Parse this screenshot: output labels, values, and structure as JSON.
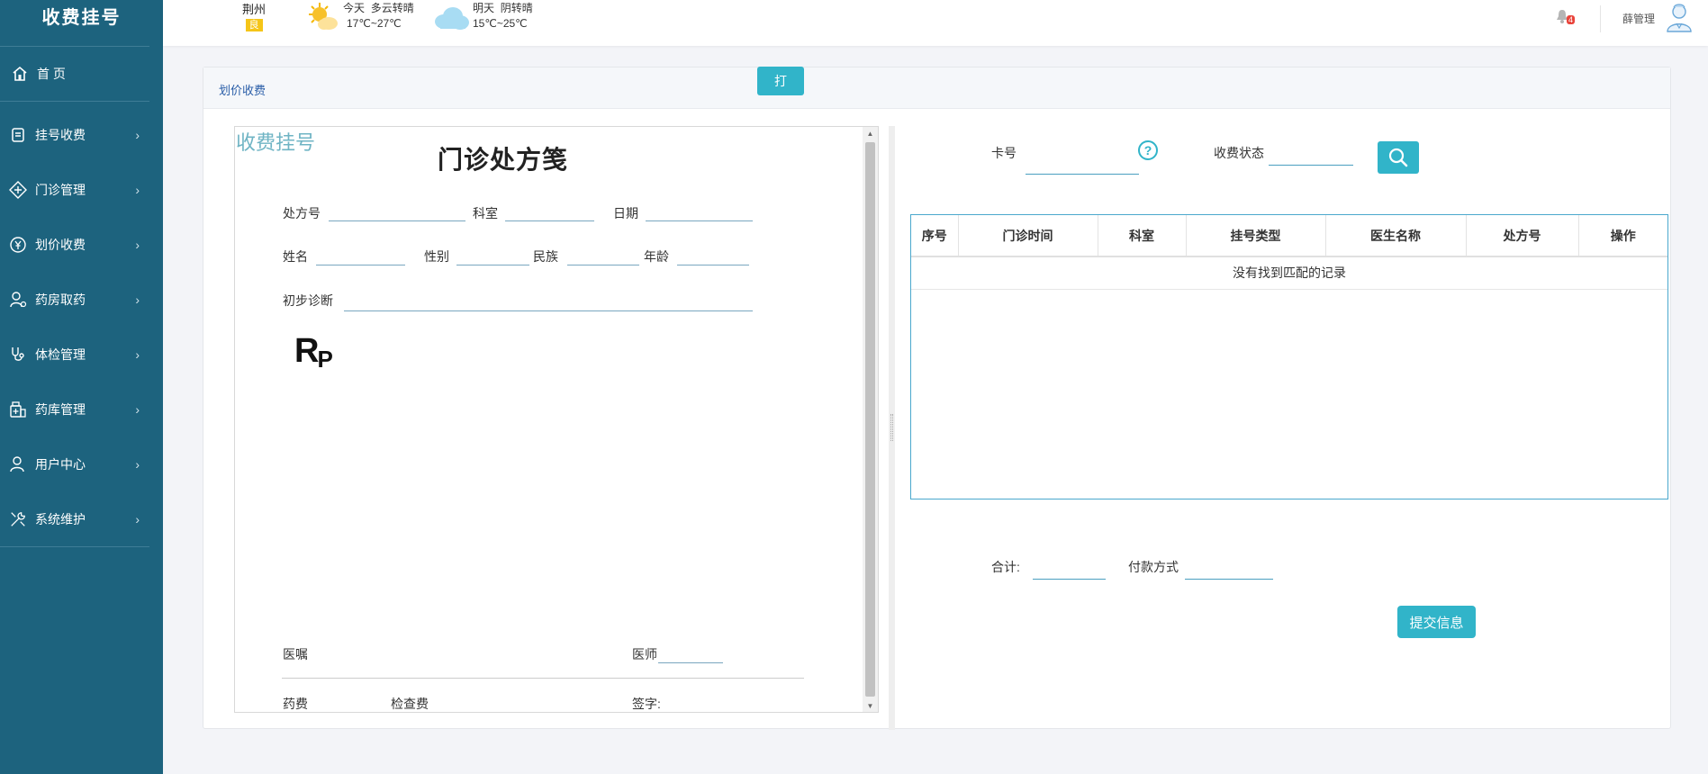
{
  "sidebar": {
    "brand": "收费挂号",
    "home": {
      "label": "首 页",
      "icon": "home-icon"
    },
    "items": [
      {
        "label": "挂号收费",
        "icon": "registration-icon"
      },
      {
        "label": "门诊管理",
        "icon": "clinic-icon"
      },
      {
        "label": "划价收费",
        "icon": "yen-icon"
      },
      {
        "label": "药房取药",
        "icon": "pharmacy-icon"
      },
      {
        "label": "体检管理",
        "icon": "stethoscope-icon"
      },
      {
        "label": "药库管理",
        "icon": "medicine-storage-icon"
      },
      {
        "label": "用户中心",
        "icon": "user-icon"
      },
      {
        "label": "系统维护",
        "icon": "tools-icon"
      }
    ]
  },
  "topbar": {
    "city": "荆州",
    "aqi": "良",
    "today": {
      "day": "今天",
      "weather": "多云转晴",
      "temp": "17℃~27℃"
    },
    "tomorrow": {
      "day": "明天",
      "weather": "阴转晴",
      "temp": "15℃~25℃"
    },
    "notifications": "4",
    "user": "薛管理"
  },
  "panel": {
    "title": "划价收费",
    "print_label": "打"
  },
  "prescription": {
    "watermark": "收费挂号",
    "title": "门诊处方笺",
    "fields": {
      "rx_no": "处方号",
      "dept": "科室",
      "date": "日期",
      "name": "姓名",
      "gender": "性别",
      "ethnicity": "民族",
      "age": "年龄",
      "diagnosis": "初步诊断",
      "advice": "医嘱",
      "doctor": "医师",
      "drug_fee": "药费",
      "exam_fee": "检查费",
      "signature": "签字:"
    },
    "rp_r": "R",
    "rp_p": "P"
  },
  "search": {
    "card_label": "卡号",
    "status_label": "收费状态"
  },
  "table": {
    "columns": [
      "序号",
      "门诊时间",
      "科室",
      "挂号类型",
      "医生名称",
      "处方号",
      "操作"
    ],
    "empty_text": "没有找到匹配的记录"
  },
  "summary": {
    "total_label": "合计:",
    "payment_label": "付款方式",
    "submit_label": "提交信息"
  },
  "colors": {
    "sidebar": "#1d637e",
    "accent": "#31b4c9",
    "title_blue": "#2a5ea8"
  }
}
